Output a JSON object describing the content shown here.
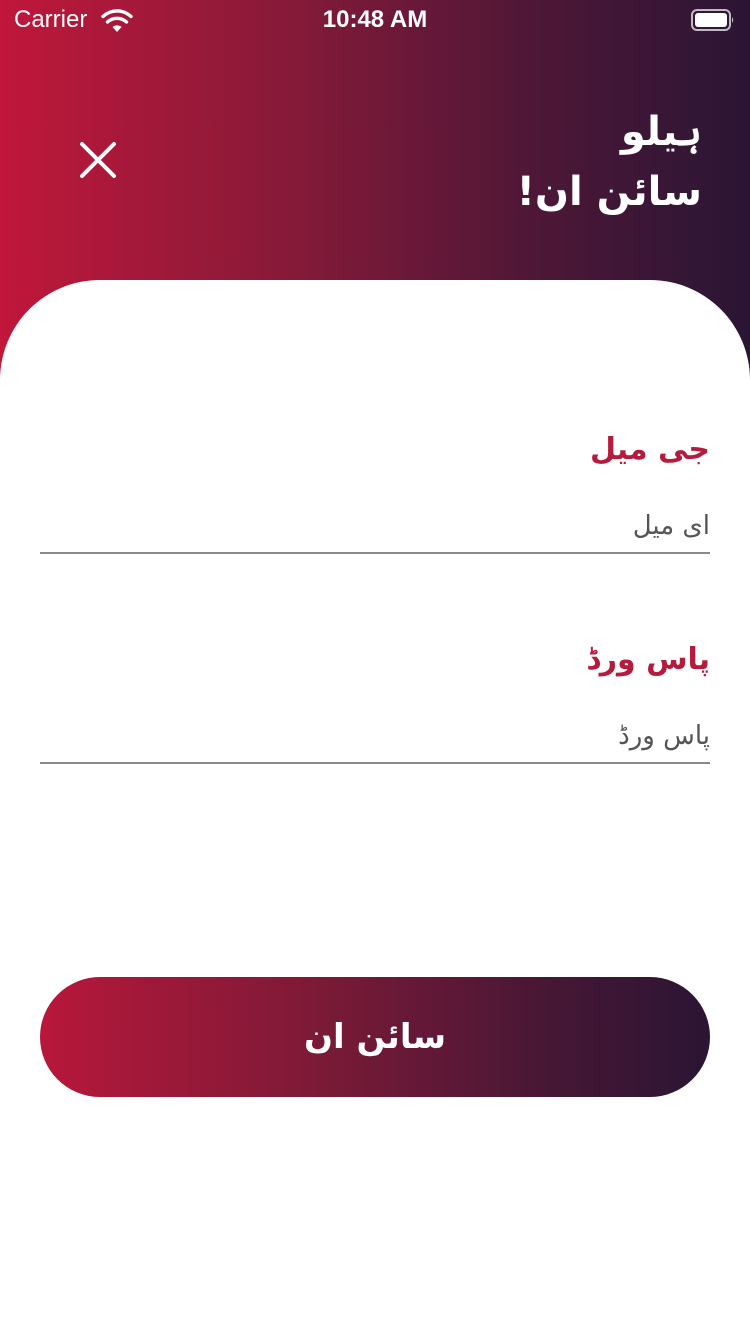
{
  "status_bar": {
    "carrier": "Carrier",
    "time": "10:48 AM",
    "wifi_icon": "wifi-icon",
    "battery_icon": "battery-icon"
  },
  "header": {
    "close_icon": "close-icon",
    "greeting_line1": "ہیلو",
    "greeting_line2": "سائن ان!",
    "gradient_start": "#c0173b",
    "gradient_end": "#2a1534"
  },
  "form": {
    "email": {
      "label": "جی میل",
      "placeholder": "ای میل",
      "value": ""
    },
    "password": {
      "label": "پاس ورڈ",
      "placeholder": "پاس ورڈ",
      "value": ""
    },
    "label_color": "#b51b3c"
  },
  "signin_button": {
    "label": "سائن ان"
  }
}
